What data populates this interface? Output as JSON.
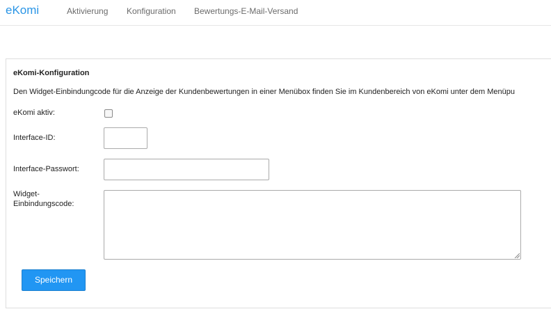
{
  "nav": {
    "brand": "eKomi",
    "links": [
      "Aktivierung",
      "Konfiguration",
      "Bewertungs-E-Mail-Versand"
    ]
  },
  "panel": {
    "title": "eKomi-Konfiguration",
    "description": "Den Widget-Einbindungcode für die Anzeige der Kundenbewertungen in einer Menübox finden Sie im Kundenbereich von eKomi unter dem Menüpu"
  },
  "form": {
    "active_label": "eKomi aktiv:",
    "active_checked": false,
    "interface_id_label": "Interface-ID:",
    "interface_id_value": "",
    "interface_password_label": "Interface-Passwort:",
    "interface_password_value": "",
    "widget_code_label_line1": "Widget-",
    "widget_code_label_line2": "Einbindungscode:",
    "widget_code_value": "",
    "save_label": "Speichern"
  },
  "colors": {
    "accent": "#2196f3",
    "brand": "#2a95e6"
  }
}
